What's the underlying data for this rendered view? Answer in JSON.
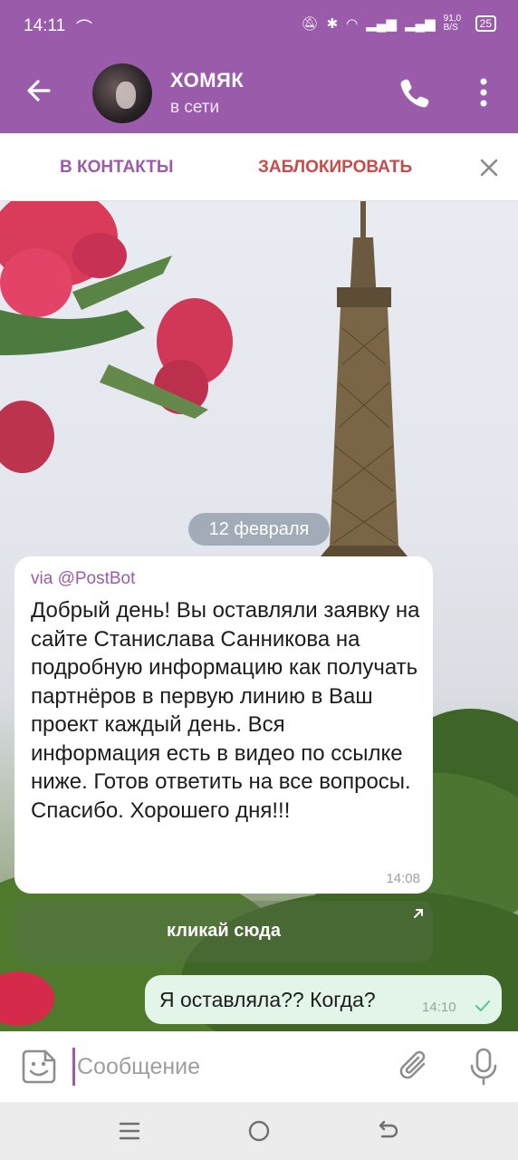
{
  "status_bar": {
    "time": "14:11",
    "network_speed": "91,0 B/S",
    "battery": "25"
  },
  "header": {
    "title": "ХОМЯК",
    "subtitle": "в сети"
  },
  "action_bar": {
    "add_contact": "В КОНТАКТЫ",
    "block": "ЗАБЛОКИРОВАТЬ"
  },
  "chat": {
    "date": "12 февраля",
    "incoming": {
      "via_prefix": "via ",
      "via_bot": "@PostBot",
      "text": "Добрый  день! Вы оставляли заявку на сайте Станислава Санникова на подробную информацию как получать партнёров в первую линию в Ваш проект каждый день. Вся информация есть в видео по ссылке ниже. Готов ответить на все вопросы. Спасибо. Хорошего дня!!!",
      "time": "14:08",
      "button_label": "кликай сюда"
    },
    "outgoing": {
      "text": "Я оставляла?? Когда?",
      "time": "14:10"
    }
  },
  "input": {
    "placeholder": "Сообщение"
  },
  "colors": {
    "accent": "#9b5bab",
    "danger": "#c74b4b",
    "outgoing_bubble": "#e3f5e9",
    "read_check": "#4fc3a1"
  },
  "icons": [
    "back-arrow-icon",
    "phone-icon",
    "more-vert-icon",
    "close-icon",
    "sticker-icon",
    "paperclip-icon",
    "microphone-icon",
    "check-icon",
    "external-link-icon"
  ]
}
